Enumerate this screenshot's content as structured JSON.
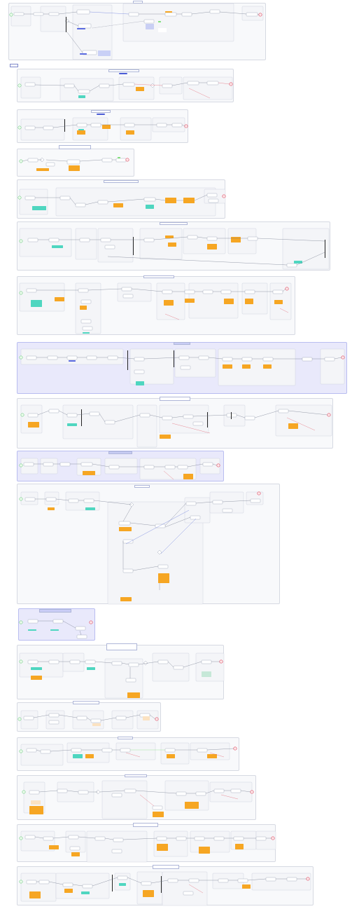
{
  "title": "",
  "diagrams": [
    {
      "id": "d1",
      "top_title": "",
      "variant": "plain"
    },
    {
      "id": "d2",
      "top_title": "",
      "variant": "plain"
    },
    {
      "id": "d3",
      "top_title": "",
      "variant": "plain"
    },
    {
      "id": "d4",
      "top_title": "",
      "variant": "plain"
    },
    {
      "id": "d5",
      "top_title": "",
      "variant": "plain"
    },
    {
      "id": "d6",
      "top_title": "",
      "variant": "plain"
    },
    {
      "id": "d7",
      "top_title": "",
      "variant": "plain"
    },
    {
      "id": "d8",
      "top_title": "",
      "variant": "lavender"
    },
    {
      "id": "d9",
      "top_title": "",
      "variant": "plain"
    },
    {
      "id": "d10",
      "top_title": "",
      "variant": "lavender"
    },
    {
      "id": "d11",
      "top_title": "",
      "variant": "plain"
    },
    {
      "id": "d12",
      "top_title": "",
      "variant": "lavender"
    },
    {
      "id": "d13",
      "top_title": "",
      "variant": "plain"
    },
    {
      "id": "d14",
      "top_title": "",
      "variant": "plain"
    },
    {
      "id": "d15",
      "top_title": "",
      "variant": "plain"
    },
    {
      "id": "d16",
      "top_title": "",
      "variant": "plain"
    },
    {
      "id": "d17",
      "top_title": "",
      "variant": "plain"
    },
    {
      "id": "d18",
      "top_title": "",
      "variant": "plain"
    }
  ],
  "colors": {
    "task_fill": "#ffffff",
    "task_border": "#8a93a8",
    "note_orange": "#f6a623",
    "note_teal": "#4fd6c0",
    "note_green": "#7fe07a",
    "note_blue": "#5b6be0",
    "lane_fill": "#f4f5f8",
    "start_event": "#57c46e",
    "end_event": "#e0526b",
    "flow": "#6b7386",
    "flow_red": "#e25d6b",
    "flow_blue": "#5a6fd8"
  }
}
